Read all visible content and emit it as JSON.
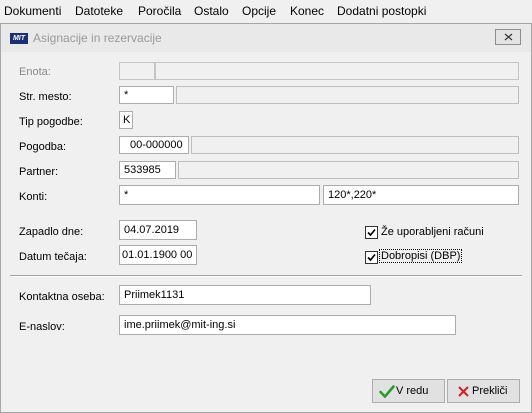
{
  "menu": [
    "Dokumenti",
    "Datoteke",
    "Poročila",
    "Ostalo",
    "Opcije",
    "Konec",
    "Dodatni postopki"
  ],
  "window": {
    "logo_text": "MIT",
    "title": "Asignacije in rezervacije"
  },
  "fields": {
    "enota": {
      "label": "Enota:",
      "code": "",
      "name": ""
    },
    "str_mesto": {
      "label": "Str. mesto:",
      "code": "*",
      "name": ""
    },
    "tip_pogodbe": {
      "label": "Tip pogodbe:",
      "value": "K"
    },
    "pogodba": {
      "label": "Pogodba:",
      "code": "00-000000",
      "name": ""
    },
    "partner": {
      "label": "Partner:",
      "code": "533985",
      "name": ""
    },
    "konti": {
      "label": "Konti:",
      "value_from": "*",
      "value_to": "120*,220*"
    },
    "zapadlo_dne": {
      "label": "Zapadlo dne:",
      "value": "04.07.2019"
    },
    "datum_tecaja": {
      "label": "Datum tečaja:",
      "value": "01.01.1900 00"
    },
    "kontaktna_oseba": {
      "label": "Kontaktna oseba:",
      "value": "Priimek1131"
    },
    "e_naslov": {
      "label": "E-naslov:",
      "value": "ime.priimek@mit-ing.si"
    }
  },
  "checkboxes": {
    "ze_uporabljeni": {
      "label": "Že uporabljeni računi",
      "checked": true
    },
    "dobropisi": {
      "label": "Dobropisi (DBP)",
      "checked": true
    }
  },
  "buttons": {
    "ok": {
      "label": "V redu",
      "icon": "checkmark-icon",
      "color": "#2e9a2e"
    },
    "cancel": {
      "label": "Prekliči",
      "icon": "x-icon",
      "color": "#d42020"
    }
  }
}
